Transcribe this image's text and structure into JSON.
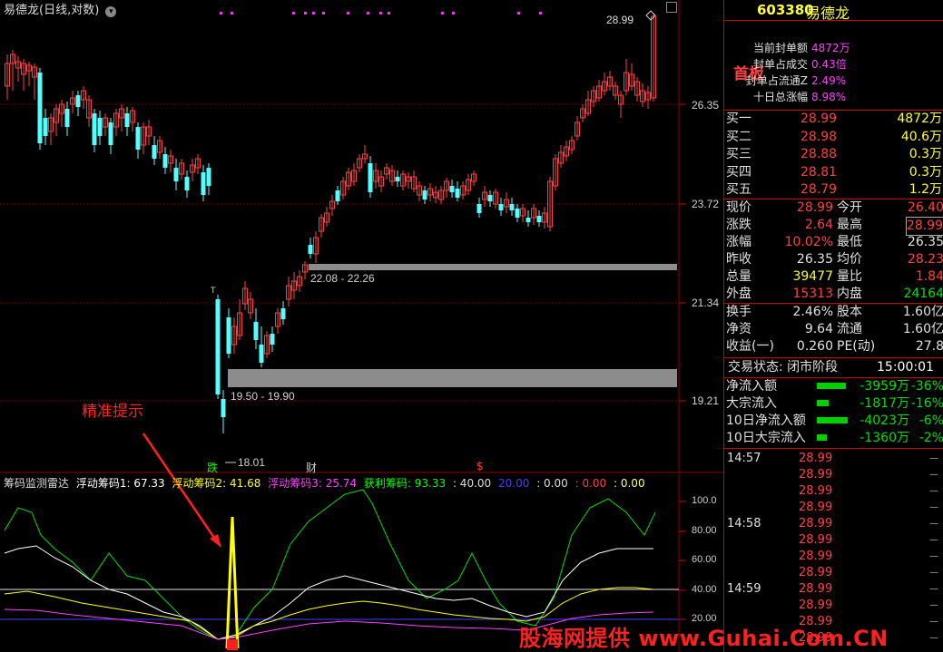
{
  "window": {
    "title": "易德龙(日线,对数)"
  },
  "chart": {
    "price_levels": [
      "26.35",
      "23.72",
      "21.34",
      "19.21"
    ],
    "high_marker": "28.99",
    "low_marker": "18.01",
    "zone_upper_label": "22.08 - 22.26",
    "zone_lower_label": "19.50 - 19.90",
    "annotation": "精准提示",
    "marker_die": "跌",
    "marker_cai": "财",
    "marker_dollar": "$",
    "marker_t": "T"
  },
  "indicator": {
    "name": "筹码监测雷达",
    "l1": "浮动筹码1: 67.33",
    "l2": "浮动筹码2: 41.68",
    "l3": "浮动筹码3: 25.74",
    "l4": "获利筹码: 93.33",
    "l5": ": 40.00",
    "l6": "20.00",
    "l7": ": 0.00",
    "l8": ": 0.00",
    "l9": ": 0.00",
    "axis": [
      "100.0",
      "80.00",
      "60.00",
      "40.00",
      "20.00"
    ]
  },
  "watermark": "股海网提供 www.Guhai.Com.CN",
  "quote": {
    "code": "603380",
    "name": "易德龙",
    "tag": "首板",
    "seal_lines": [
      {
        "label": "当前封单额",
        "value": "4872万"
      },
      {
        "label": "封单占成交",
        "value": "0.43倍"
      },
      {
        "label": "封单占流通Z",
        "value": "2.49%"
      },
      {
        "label": "十日总涨幅",
        "value": "8.98%"
      }
    ],
    "bids": [
      {
        "label": "买一",
        "price": "28.99",
        "vol": "4872万"
      },
      {
        "label": "买二",
        "price": "28.98",
        "vol": "40.6万"
      },
      {
        "label": "买三",
        "price": "28.88",
        "vol": "0.3万"
      },
      {
        "label": "买四",
        "price": "28.81",
        "vol": "0.3万"
      },
      {
        "label": "买五",
        "price": "28.79",
        "vol": "1.2万"
      }
    ],
    "stats": [
      {
        "l1": "现价",
        "v1": "28.99",
        "l2": "今开",
        "v2": "26.40"
      },
      {
        "l1": "涨跌",
        "v1": "2.64",
        "l2": "最高",
        "v2": "28.99"
      },
      {
        "l1": "涨幅",
        "v1": "10.02%",
        "l2": "最低",
        "v2": "26.35"
      },
      {
        "l1": "昨收",
        "v1": "26.35",
        "l2": "均价",
        "v2": "28.23"
      },
      {
        "l1": "总量",
        "v1": "39477",
        "l2": "量比",
        "v2": "1.84"
      },
      {
        "l1": "外盘",
        "v1": "15313",
        "l2": "内盘",
        "v2": "24164"
      }
    ],
    "stats2": [
      {
        "l1": "换手",
        "v1": "2.46%",
        "l2": "股本",
        "v2": "1.60亿"
      },
      {
        "l1": "净资",
        "v1": "9.64",
        "l2": "流通",
        "v2": "1.60亿"
      },
      {
        "l1": "收益(一)",
        "v1": "0.260",
        "l2": "PE(动)",
        "v2": "27.8"
      }
    ],
    "status_label": "交易状态: 闭市阶段",
    "status_time": "15:00:01",
    "flows": [
      {
        "label": "净流入额",
        "value": "-3959万",
        "pct": "-36%",
        "bar": 0.9
      },
      {
        "label": "大宗流入",
        "value": "-1817万",
        "pct": "-16%",
        "bar": 0.35
      },
      {
        "label": "10日净流入额",
        "value": "-4023万",
        "pct": "-6%",
        "bar": 0.95
      },
      {
        "label": "10日大宗流入",
        "value": "-1360万",
        "pct": "-2%",
        "bar": 0.3
      }
    ],
    "ticks": [
      {
        "time": "14:57",
        "price": "28.99"
      },
      {
        "time": "",
        "price": "28.99"
      },
      {
        "time": "",
        "price": "28.99"
      },
      {
        "time": "",
        "price": "28.99"
      },
      {
        "time": "14:58",
        "price": "28.99"
      },
      {
        "time": "",
        "price": "28.99"
      },
      {
        "time": "",
        "price": "28.99"
      },
      {
        "time": "",
        "price": "28.99"
      },
      {
        "time": "14:59",
        "price": "28.99"
      },
      {
        "time": "",
        "price": "28.99"
      },
      {
        "time": "",
        "price": "28.99"
      },
      {
        "time": "",
        "price": "28.99"
      }
    ]
  },
  "colors": {
    "up": "#ff4040",
    "down": "#54ffff",
    "grid": "#8b0000",
    "zone": "#8c8c8c"
  }
}
